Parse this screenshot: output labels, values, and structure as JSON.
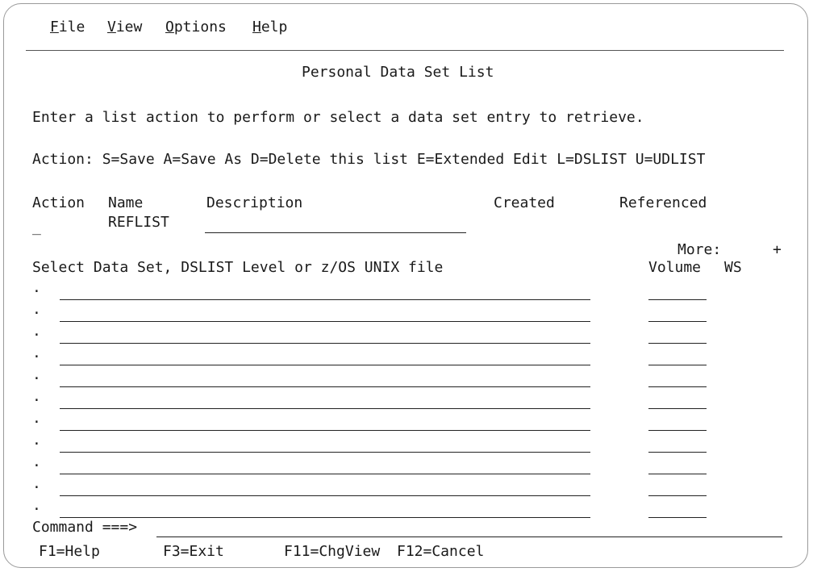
{
  "menu": {
    "items": [
      {
        "label": "File",
        "mnemonic": "F",
        "rest": "ile"
      },
      {
        "label": "View",
        "mnemonic": "V",
        "rest": "iew"
      },
      {
        "label": "Options",
        "mnemonic": "O",
        "rest": "ptions"
      },
      {
        "label": "Help",
        "mnemonic": "H",
        "rest": "elp"
      }
    ]
  },
  "panel": {
    "title": "Personal Data Set List",
    "instruction": "Enter a list action to perform or select a data set entry to retrieve.",
    "actions": "Action: S=Save A=Save As D=Delete this list E=Extended Edit L=DSLIST U=UDLIST"
  },
  "list_header": {
    "action": "Action",
    "name": "Name",
    "description": "Description",
    "created": "Created",
    "referenced": "Referenced"
  },
  "list_entry": {
    "action_value": "_",
    "name": "REFLIST",
    "description": "",
    "created": "",
    "referenced": ""
  },
  "more": {
    "label": "More:",
    "indicator": "+"
  },
  "dataset_header": {
    "select": "Select Data Set, DSLIST Level or z/OS UNIX file",
    "volume": "Volume",
    "ws": "WS"
  },
  "dataset_rows": [
    {
      "marker": ".",
      "dataset": "",
      "volume": ""
    },
    {
      "marker": ".",
      "dataset": "",
      "volume": ""
    },
    {
      "marker": ".",
      "dataset": "",
      "volume": ""
    },
    {
      "marker": ".",
      "dataset": "",
      "volume": ""
    },
    {
      "marker": ".",
      "dataset": "",
      "volume": ""
    },
    {
      "marker": ".",
      "dataset": "",
      "volume": ""
    },
    {
      "marker": ".",
      "dataset": "",
      "volume": ""
    },
    {
      "marker": ".",
      "dataset": "",
      "volume": ""
    },
    {
      "marker": ".",
      "dataset": "",
      "volume": ""
    },
    {
      "marker": ".",
      "dataset": "",
      "volume": ""
    },
    {
      "marker": ".",
      "dataset": "",
      "volume": ""
    }
  ],
  "command": {
    "label": "Command ===>",
    "value": ""
  },
  "function_keys": [
    "F1=Help",
    "F3=Exit",
    "F11=ChgView",
    "F12=Cancel"
  ]
}
